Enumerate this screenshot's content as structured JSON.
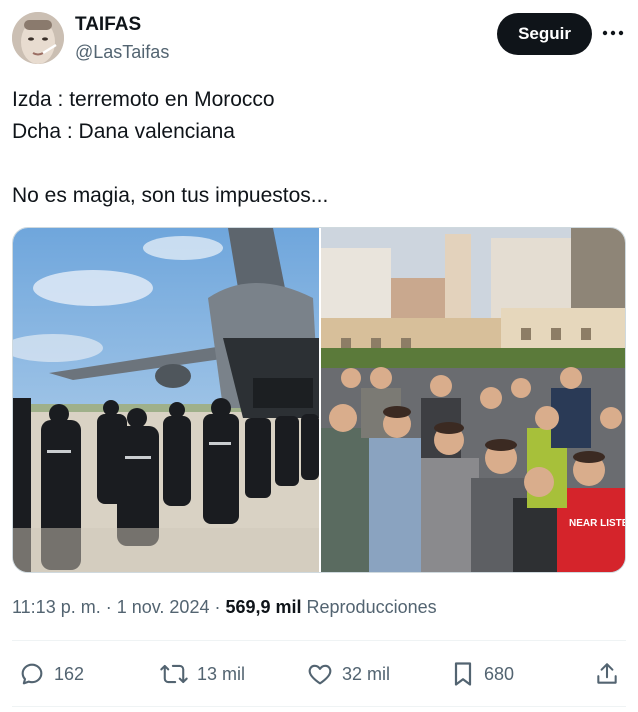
{
  "author": {
    "name": "TAIFAS",
    "handle": "@LasTaifas"
  },
  "follow_label": "Seguir",
  "tweet": {
    "lines": [
      "Izda : terremoto en Morocco",
      "Dcha : Dana valenciana",
      "No es magia, son tus impuestos..."
    ]
  },
  "meta": {
    "time": "11:13 p. m.",
    "separator1": " · ",
    "date": "1 nov. 2024",
    "separator2": " · ",
    "views": "569,9 mil",
    "views_label": " Reproducciones"
  },
  "actions": {
    "replies": "162",
    "retweets": "13 mil",
    "likes": "32 mil",
    "bookmarks": "680"
  },
  "images": {
    "left_icon": "military-plane-photo",
    "right_icon": "crowd-volunteers-photo",
    "jersey_text": "NEAR LISTEN FEEL"
  }
}
